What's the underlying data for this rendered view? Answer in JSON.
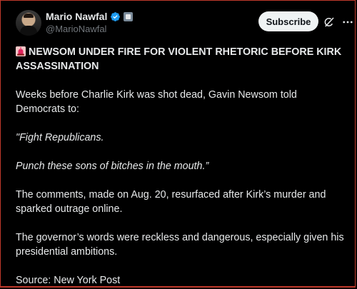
{
  "author": {
    "display_name": "Mario Nawfal",
    "handle": "@MarioNawfal"
  },
  "actions": {
    "subscribe_label": "Subscribe"
  },
  "icons": {
    "verified": "verified-badge-icon",
    "affiliation": "affiliation-badge-icon",
    "grok": "grok-icon",
    "more": "more-options-icon",
    "siren": "siren-emoji-icon"
  },
  "colors": {
    "background": "#000000",
    "text": "#e7e9ea",
    "secondary_text": "#71767b",
    "verified_blue": "#1d9bf0",
    "button_bg": "#eff3f4",
    "frame_red": "#c0392b"
  },
  "post": {
    "headline": "NEWSOM UNDER FIRE FOR VIOLENT RHETORIC BEFORE KIRK ASSASSINATION",
    "paragraphs": [
      "Weeks before Charlie Kirk was shot dead, Gavin Newsom told Democrats to:",
      "\"Fight Republicans.",
      "Punch these sons of bitches in the mouth.”",
      "The comments, made on Aug. 20, resurfaced after Kirk’s murder and sparked outrage online.",
      "The governor’s words were reckless and dangerous, especially given his presidential ambitions.",
      "Source: New York Post"
    ]
  }
}
